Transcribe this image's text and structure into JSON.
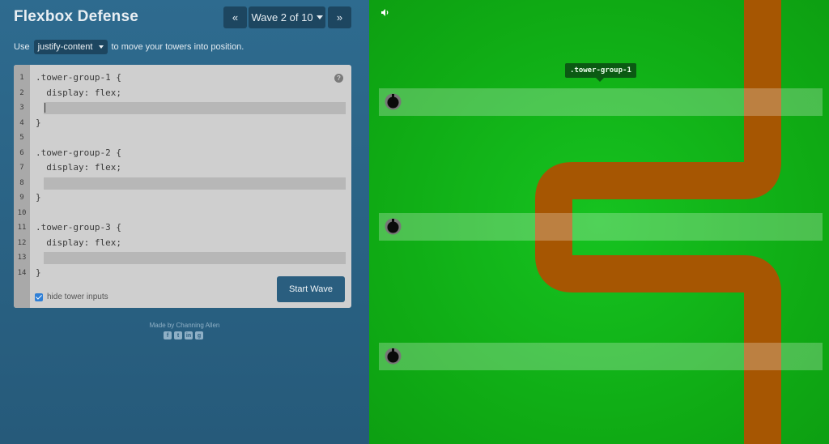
{
  "header": {
    "title": "Flexbox Defense",
    "prev_label": "«",
    "wave_label": "Wave 2 of 10",
    "next_label": "»"
  },
  "instructions": {
    "prefix": "Use",
    "property": "justify-content",
    "suffix": "to move your towers into position."
  },
  "editor": {
    "line_numbers": [
      "1",
      "2",
      "3",
      "4",
      "5",
      "6",
      "7",
      "8",
      "9",
      "10",
      "11",
      "12",
      "13",
      "14"
    ],
    "lines": {
      "l1": ".tower-group-1 {",
      "l2": "  display: flex;",
      "l4": "}",
      "l6": ".tower-group-2 {",
      "l7": "  display: flex;",
      "l9": "}",
      "l11": ".tower-group-3 {",
      "l12": "  display: flex;",
      "l14": "}"
    },
    "inputs": [
      "",
      "",
      ""
    ],
    "help_icon": "?",
    "hide_inputs_label": "hide tower inputs",
    "hide_inputs_checked": true,
    "start_label": "Start Wave"
  },
  "footer": {
    "credit": "Made by Channing Allen",
    "social_icons": [
      "facebook-icon",
      "twitter-icon",
      "linkedin-icon",
      "github-icon"
    ]
  },
  "board": {
    "tooltip": ".tower-group-1",
    "icons": [
      "sound-icon",
      "tower-icon"
    ],
    "colors": {
      "grass": "#12b51a",
      "path": "#a65602",
      "lane": "rgba(255,255,255,0.25)",
      "tower": "#111111"
    }
  }
}
